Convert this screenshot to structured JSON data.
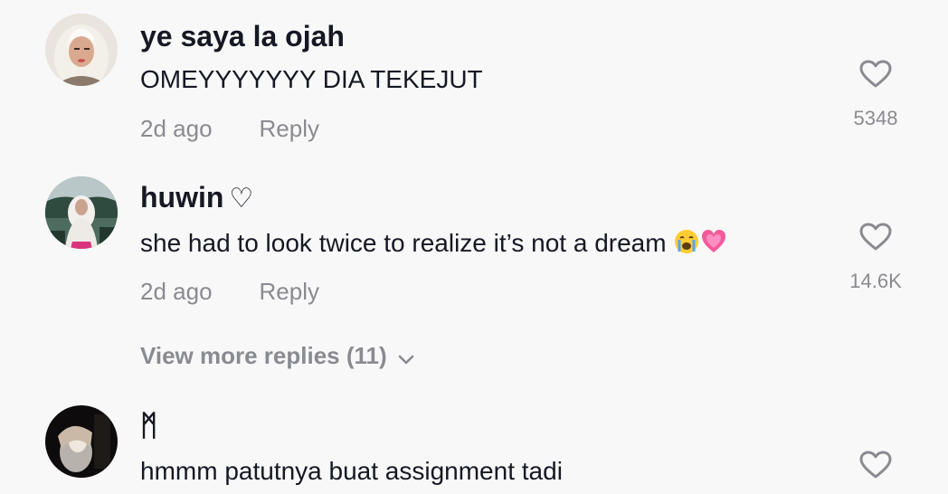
{
  "comments": [
    {
      "username": "ye saya la ojah",
      "text": "OMEYYYYYYY DIA TEKEJUT",
      "time": "2d ago",
      "reply_label": "Reply",
      "like_count": "5348",
      "avatar_icon": "avatar-hijab-photo"
    },
    {
      "username": "huwin",
      "username_decoration": "♡",
      "text": "she had to look twice to realize it’s not a dream",
      "emojis": [
        "loudly-crying-face-emoji",
        "growing-heart-emoji"
      ],
      "time": "2d ago",
      "reply_label": "Reply",
      "like_count": "14.6K",
      "avatar_icon": "avatar-hijab-outdoor-photo"
    },
    {
      "username": "ᛗ",
      "text": "hmmm patutnya buat assignment tadi",
      "avatar_icon": "avatar-dark-photo"
    }
  ],
  "view_more": {
    "label": "View more replies (11)",
    "icon": "chevron-down-icon"
  },
  "colors": {
    "background": "#f8f8f8",
    "primary_text": "#161823",
    "secondary_text": "#8a8b91"
  }
}
